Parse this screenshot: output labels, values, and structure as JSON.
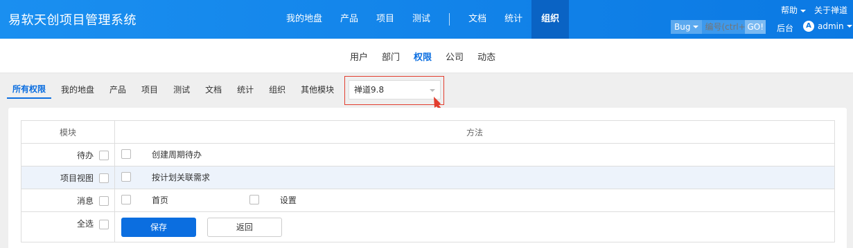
{
  "header": {
    "brand": "易软天创项目管理系统",
    "nav": [
      {
        "label": "我的地盘",
        "active": false
      },
      {
        "label": "产品",
        "active": false
      },
      {
        "label": "项目",
        "active": false
      },
      {
        "label": "测试",
        "active": false
      },
      {
        "label": "文档",
        "active": false
      },
      {
        "label": "统计",
        "active": false
      },
      {
        "label": "组织",
        "active": true
      }
    ],
    "help": "帮助",
    "about": "关于禅道",
    "search": {
      "type": "Bug",
      "placeholder": "编号(ctrl+g",
      "go": "GO!"
    },
    "backend": "后台",
    "user": {
      "avatar": "A",
      "name": "admin"
    }
  },
  "subnav": {
    "items": [
      {
        "label": "用户",
        "active": false
      },
      {
        "label": "部门",
        "active": false
      },
      {
        "label": "权限",
        "active": true
      },
      {
        "label": "公司",
        "active": false
      },
      {
        "label": "动态",
        "active": false
      }
    ]
  },
  "module_tabs": [
    {
      "label": "所有权限",
      "active": true
    },
    {
      "label": "我的地盘",
      "active": false
    },
    {
      "label": "产品",
      "active": false
    },
    {
      "label": "项目",
      "active": false
    },
    {
      "label": "测试",
      "active": false
    },
    {
      "label": "文档",
      "active": false
    },
    {
      "label": "统计",
      "active": false
    },
    {
      "label": "组织",
      "active": false
    },
    {
      "label": "其他模块",
      "active": false
    }
  ],
  "version_select": {
    "value": "禅道9.8"
  },
  "table": {
    "headers": {
      "module": "模块",
      "method": "方法"
    },
    "rows": [
      {
        "module": "待办",
        "methods": [
          "创建周期待办"
        ],
        "highlight": false
      },
      {
        "module": "项目视图",
        "methods": [
          "按计划关联需求"
        ],
        "highlight": true
      },
      {
        "module": "消息",
        "methods": [
          "首页",
          "设置"
        ],
        "highlight": false
      }
    ],
    "select_all": "全选",
    "save": "保存",
    "back": "返回"
  },
  "colors": {
    "header": "#0b79e3",
    "accent": "#0b6ee0",
    "highlight_border": "#e23d2e"
  }
}
